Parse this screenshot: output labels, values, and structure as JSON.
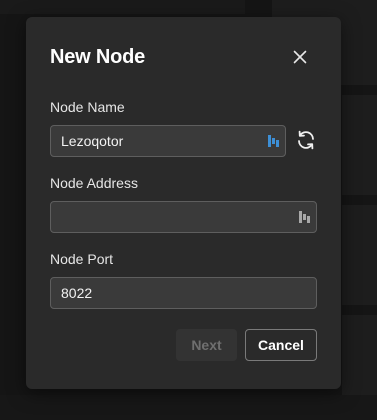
{
  "dialog": {
    "title": "New Node",
    "close_icon": "close-icon"
  },
  "fields": {
    "name": {
      "label": "Node Name",
      "value": "Lezoqotor",
      "placeholder": "",
      "icon": "password-manager-icon",
      "action_icon": "refresh-icon"
    },
    "address": {
      "label": "Node Address",
      "value": "",
      "placeholder": "",
      "icon": "password-manager-icon"
    },
    "port": {
      "label": "Node Port",
      "value": "8022",
      "placeholder": ""
    }
  },
  "buttons": {
    "next_label": "Next",
    "next_disabled": true,
    "cancel_label": "Cancel"
  },
  "colors": {
    "dialog_bg": "#2a2a2a",
    "input_bg": "#3a3a3a",
    "input_border": "#5e5e5e",
    "text": "#ffffff",
    "disabled_text": "#6f6f6f",
    "icon_accent": "#3d8fd6"
  }
}
